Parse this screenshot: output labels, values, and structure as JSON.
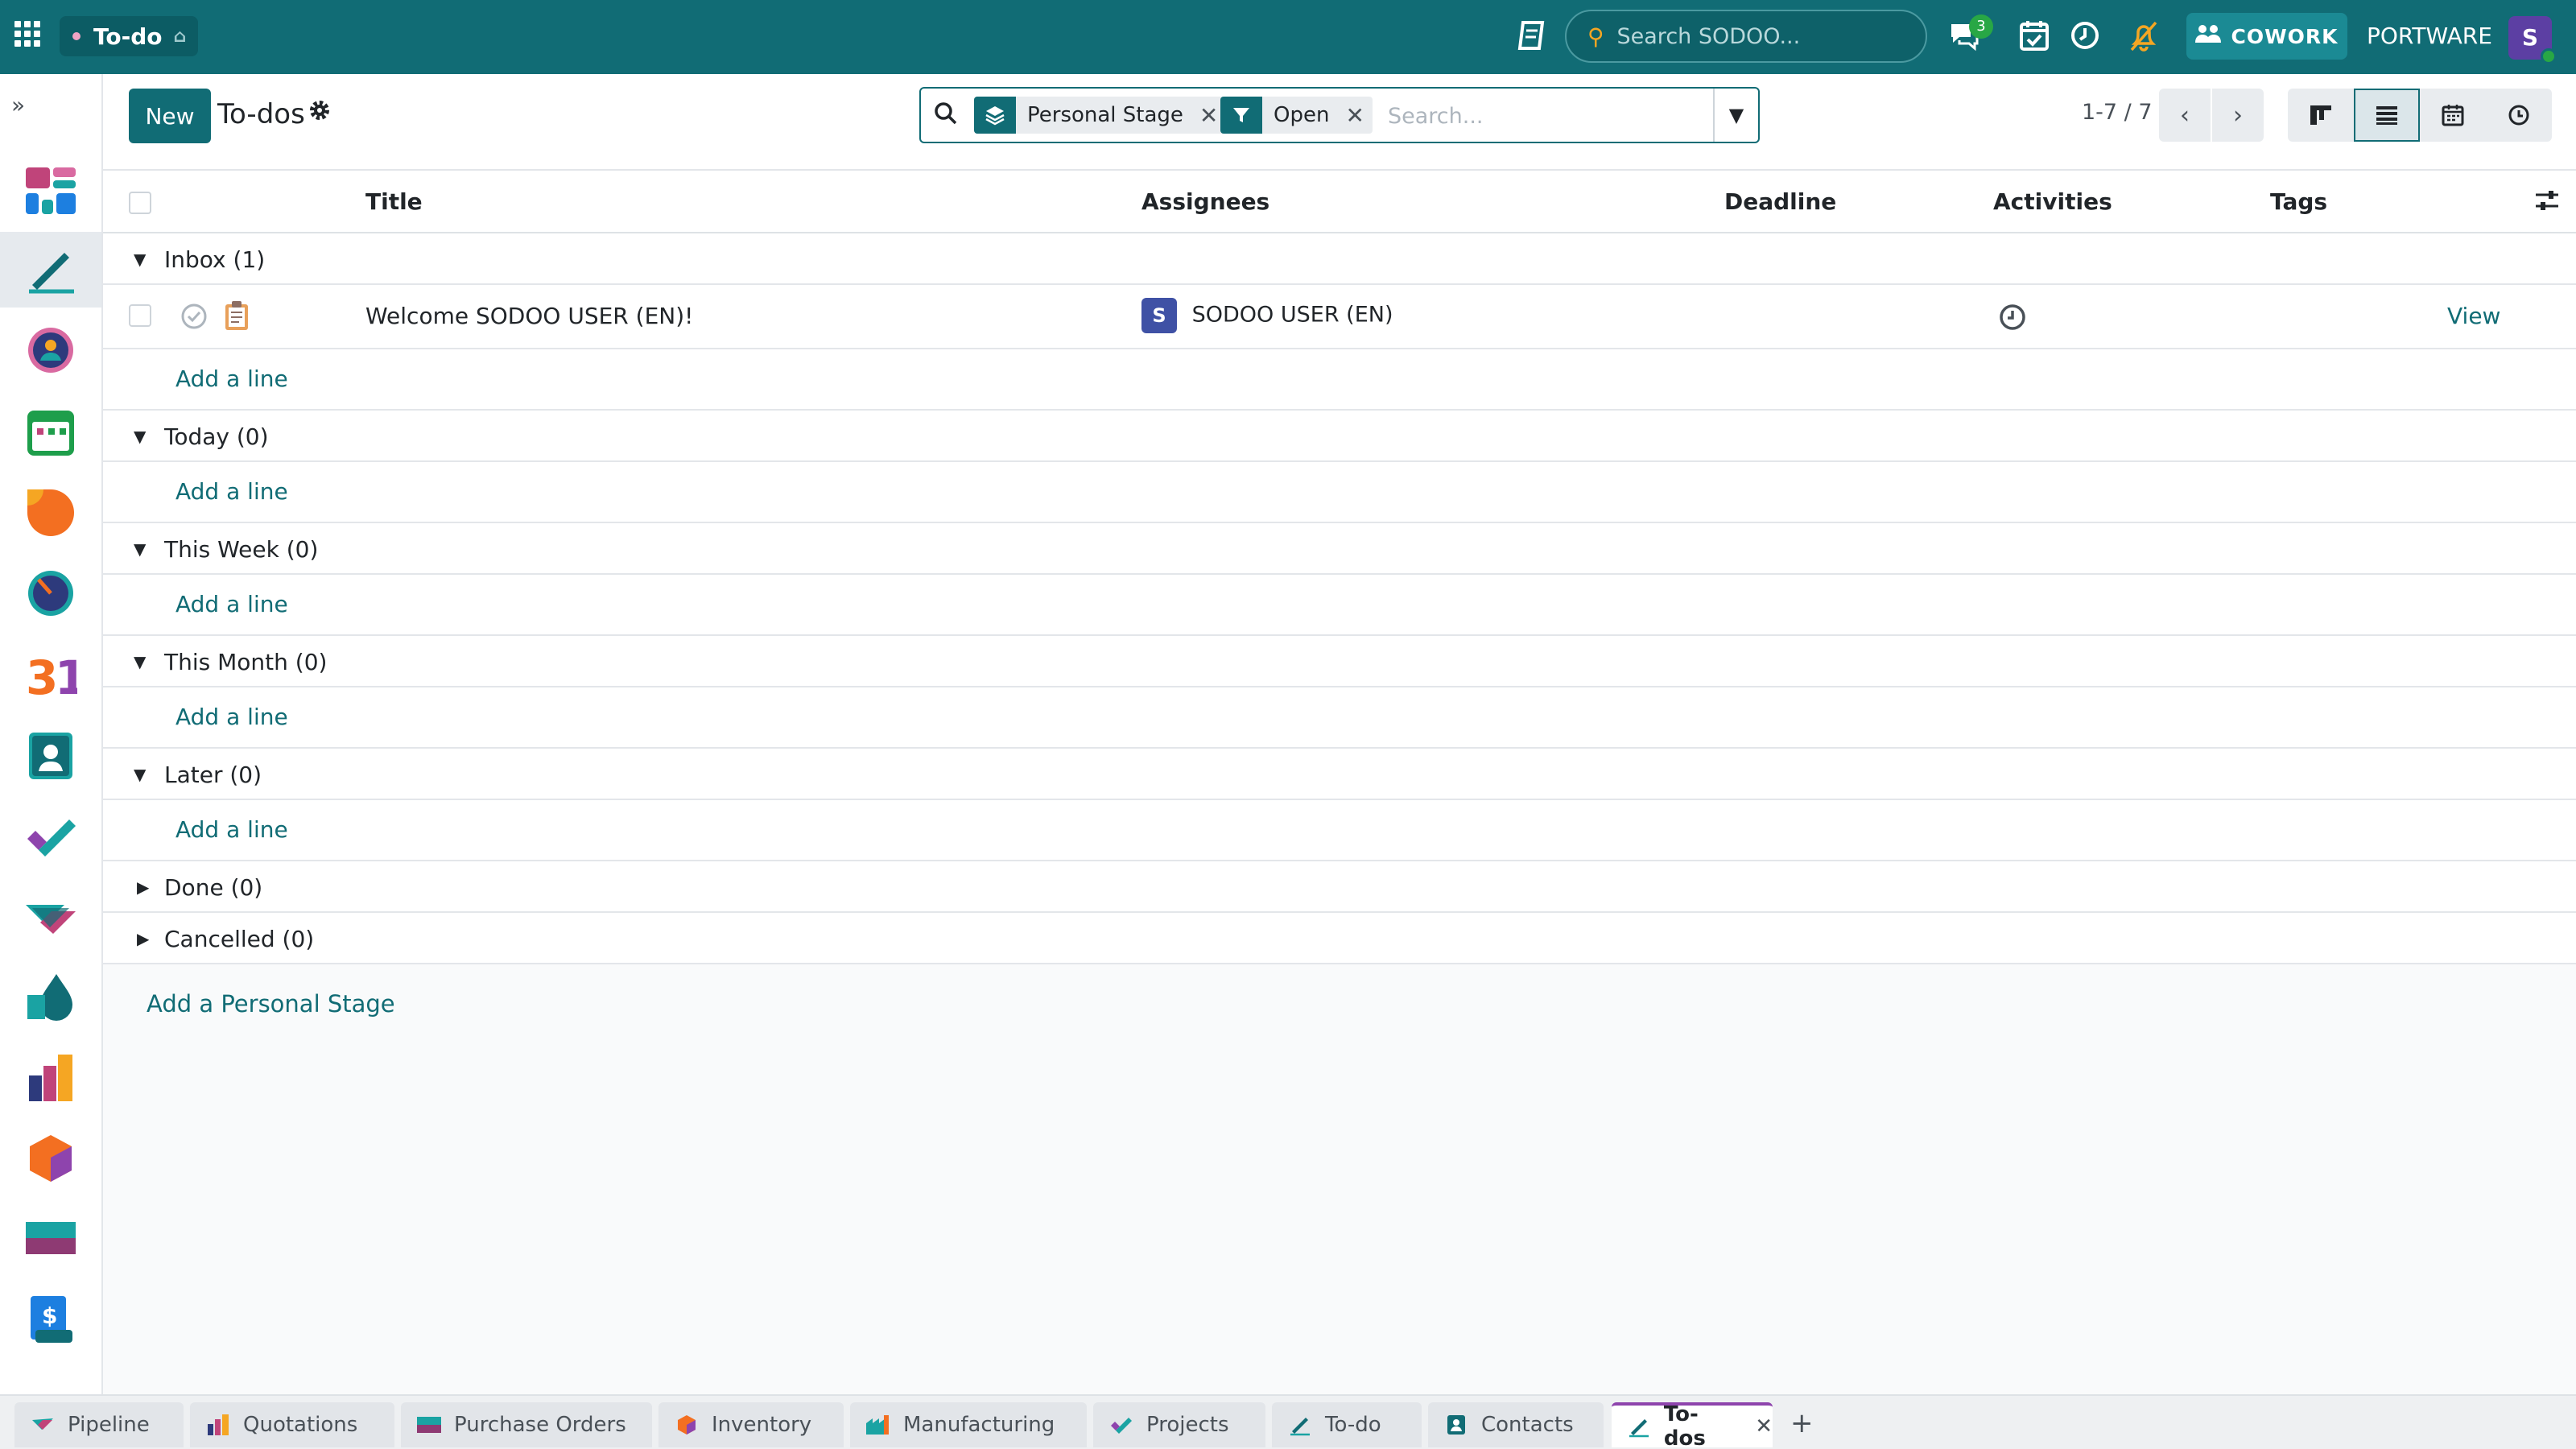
{
  "navbar": {
    "app_name": "To-do",
    "search_placeholder": "Search SODOO...",
    "chat_badge": "3",
    "cowork_label": "COWORK",
    "company": "PORTWARE",
    "user_initial": "S"
  },
  "sidebar": {
    "items": [
      "dashboard",
      "to-do",
      "discuss",
      "calendar",
      "crm",
      "timesheet",
      "calendar-31",
      "contacts",
      "projects",
      "sales",
      "drip",
      "reports",
      "inventory",
      "purchase",
      "invoicing"
    ]
  },
  "control": {
    "new_label": "New",
    "title": "To-dos",
    "facets": [
      {
        "label": "Personal Stage",
        "icon": "layers-icon"
      },
      {
        "label": "Open",
        "icon": "filter-icon"
      }
    ],
    "search_placeholder": "Search...",
    "pager": "1-7 / 7"
  },
  "list": {
    "columns": [
      "Title",
      "Assignees",
      "Deadline",
      "Activities",
      "Tags"
    ],
    "groups": [
      {
        "label": "Inbox (1)",
        "expanded": true
      },
      {
        "label": "Today (0)",
        "expanded": true
      },
      {
        "label": "This Week (0)",
        "expanded": true
      },
      {
        "label": "This Month (0)",
        "expanded": true
      },
      {
        "label": "Later (0)",
        "expanded": true
      },
      {
        "label": "Done (0)",
        "expanded": false
      },
      {
        "label": "Cancelled (0)",
        "expanded": false
      }
    ],
    "records": [
      {
        "title": "Welcome SODOO USER (EN)!",
        "assignee_initial": "S",
        "assignee": "SODOO USER (EN)",
        "deadline": "",
        "tags": "",
        "action": "View"
      }
    ],
    "add_line_label": "Add a line",
    "add_stage_label": "Add a Personal Stage"
  },
  "tabs": [
    {
      "label": "Pipeline"
    },
    {
      "label": "Quotations"
    },
    {
      "label": "Purchase Orders"
    },
    {
      "label": "Inventory"
    },
    {
      "label": "Manufacturing"
    },
    {
      "label": "Projects"
    },
    {
      "label": "To-do"
    },
    {
      "label": "Contacts"
    },
    {
      "label": "To-dos",
      "active": true
    }
  ],
  "colors": {
    "primary": "#116c75",
    "active_tab_accent": "#8e44ad"
  }
}
